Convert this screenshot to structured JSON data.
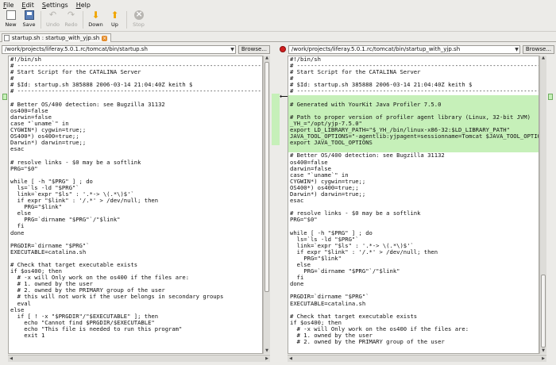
{
  "menu": [
    "File",
    "Edit",
    "Settings",
    "Help"
  ],
  "toolbar": {
    "new": "New",
    "save": "Save",
    "undo": "Undo",
    "redo": "Redo",
    "down": "Down",
    "up": "Up",
    "stop": "Stop"
  },
  "tab": {
    "label": "startup.sh : startup_with_yjp.sh"
  },
  "left": {
    "path": "/work/projects/liferay.5.0.1.rc/tomcat/bin/startup.sh",
    "browse": "Browse...",
    "lines": [
      "#!/bin/sh",
      "# -----------------------------------------------------------------------",
      "# Start Script for the CATALINA Server",
      "#",
      "# $Id: startup.sh 385888 2006-03-14 21:04:40Z keith $",
      "# -----------------------------------------------------------------------",
      "",
      "# Better OS/400 detection: see Bugzilla 31132",
      "os400=false",
      "darwin=false",
      "case \"`uname`\" in",
      "CYGWIN*) cygwin=true;;",
      "OS400*) os400=true;;",
      "Darwin*) darwin=true;;",
      "esac",
      "",
      "# resolve links - $0 may be a softlink",
      "PRG=\"$0\"",
      "",
      "while [ -h \"$PRG\" ] ; do",
      "  ls=`ls -ld \"$PRG\"`",
      "  link=`expr \"$ls\" : '.*-> \\(.*\\)$'`",
      "  if expr \"$link\" : '/.*' > /dev/null; then",
      "    PRG=\"$link\"",
      "  else",
      "    PRG=`dirname \"$PRG\"`/\"$link\"",
      "  fi",
      "done",
      "",
      "PRGDIR=`dirname \"$PRG\"`",
      "EXECUTABLE=catalina.sh",
      "",
      "# Check that target executable exists",
      "if $os400; then",
      "  # -x will Only work on the os400 if the files are:",
      "  # 1. owned by the user",
      "  # 2. owned by the PRIMARY group of the user",
      "  # this will not work if the user belongs in secondary groups",
      "  eval",
      "else",
      "  if [ ! -x \"$PRGDIR\"/\"$EXECUTABLE\" ]; then",
      "    echo \"Cannot find $PRGDIR/$EXECUTABLE\"",
      "    echo \"This file is needed to run this program\"",
      "    exit 1"
    ]
  },
  "right": {
    "path": "/work/projects/liferay.5.0.1.rc/tomcat/bin/startup_with_yjp.sh",
    "browse": "Browse...",
    "lines": [
      "#!/bin/sh",
      "# -----------------------------------------------------------------------",
      "# Start Script for the CATALINA Server",
      "#",
      "# $Id: startup.sh 385888 2006-03-14 21:04:40Z keith $",
      "# -----------------------------------------------------------------------",
      "",
      "# Generated with YourKit Java Profiler 7.5.0",
      "",
      "# Path to proper version of profiler agent library (Linux, 32-bit JVM)",
      "_YH_=\"/opt/yjp-7.5.0\"",
      "export LD_LIBRARY_PATH=\"$_YH_/bin/linux-x86-32:$LD_LIBRARY_PATH\"",
      "JAVA_TOOL_OPTIONS=\"-agentlib:yjpagent=sessionname=Tomcat $JAVA_TOOL_OPTIONS\"",
      "export JAVA_TOOL_OPTIONS",
      "",
      "# Better OS/400 detection: see Bugzilla 31132",
      "os400=false",
      "darwin=false",
      "case \"`uname`\" in",
      "CYGWIN*) cygwin=true;;",
      "OS400*) os400=true;;",
      "Darwin*) darwin=true;;",
      "esac",
      "",
      "# resolve links - $0 may be a softlink",
      "PRG=\"$0\"",
      "",
      "while [ -h \"$PRG\" ] ; do",
      "  ls=`ls -ld \"$PRG\"`",
      "  link=`expr \"$ls\" : '.*-> \\(.*\\)$'`",
      "  if expr \"$link\" : '/.*' > /dev/null; then",
      "    PRG=\"$link\"",
      "  else",
      "    PRG=`dirname \"$PRG\"`/\"$link\"",
      "  fi",
      "done",
      "",
      "PRGDIR=`dirname \"$PRG\"`",
      "EXECUTABLE=catalina.sh",
      "",
      "# Check that target executable exists",
      "if $os400; then",
      "  # -x will Only work on the os400 if the files are:",
      "  # 1. owned by the user",
      "  # 2. owned by the PRIMARY group of the user"
    ],
    "highlight_from": 6,
    "highlight_to": 14
  },
  "colors": {
    "added": "#c6f0b9",
    "accent": "#f0a400",
    "stop_dot": "#d01e1e"
  }
}
